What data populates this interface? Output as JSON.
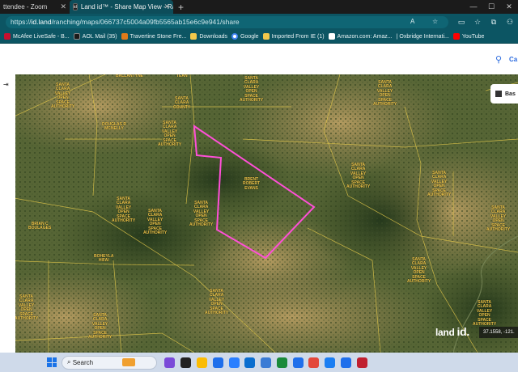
{
  "browser": {
    "tabs": [
      {
        "title": "ttendee - Zoom"
      },
      {
        "title": "Land id™ - Share Map View - Ra"
      }
    ],
    "tab_favicon_text": "id",
    "new_tab_symbol": "+",
    "url_prefix": "https://",
    "url_host": "id.land",
    "url_path": "/ranching/maps/066737c5004a09fb5565ab15e6c9e941/share",
    "bookmarks": [
      {
        "label": "McAfee LiveSafe - B...",
        "color": "#c8102e"
      },
      {
        "label": "AOL Mail (35)",
        "color": "#1a1a1a"
      },
      {
        "label": "Travertine Stone Fre...",
        "color": "#e07b1a"
      },
      {
        "label": "Downloads",
        "color": "#f2c84b"
      },
      {
        "label": "Google",
        "color": "#4285f4"
      },
      {
        "label": "Imported From IE (1)",
        "color": "#f2c84b"
      },
      {
        "label": "Amazon.com: Amaz...",
        "color": "#111111"
      },
      {
        "label": "| Oxbridge Internati...",
        "color": "#0c5563"
      },
      {
        "label": "YouTube",
        "color": "#ff0000"
      }
    ]
  },
  "site": {
    "location_label": "Ca",
    "basemap_label": "Bas",
    "logo_text": "land",
    "logo_id": "id.",
    "coordinates": "37.1558, -121."
  },
  "map_labels": [
    {
      "text": "BALLANTYNE"
    },
    {
      "text": "TEAN"
    },
    {
      "text": "SANTA\nCLARA\nVALLEY\nOPEN\nSPACE\nAUTHORITY"
    },
    {
      "text": "SANTA\nCLARA\nCOUNTY"
    },
    {
      "text": "SANTA\nCLARA\nVALLEY\nOPEN\nSPACE\nAUTHORITY"
    },
    {
      "text": "SANTA\nCLARA\nVALLEY\nOPEN\nSPACE\nAUTHORITY"
    },
    {
      "text": "DOUGLAS R\nMCNELLY"
    },
    {
      "text": "SANTA\nCLARA\nVALLEY\nOPEN\nSPACE\nAUTHORITY"
    },
    {
      "text": "BRENT\nROBERT\nEVANS"
    },
    {
      "text": "SANTA\nCLARA\nVALLEY\nOPEN\nSPACE\nAUTHORITY"
    },
    {
      "text": "SANTA\nCLARA\nVALLEY\nOPEN\nSPACE\nAUTHORITY"
    },
    {
      "text": "BRIAN C\nBOULAGES"
    },
    {
      "text": "SANTA\nCLARA\nVALLEY\nOPEN\nSPACE\nAUTHORITY"
    },
    {
      "text": "SANTA\nCLARA\nVALLEY\nOPEN\nSPACE\nAUTHORITY"
    },
    {
      "text": "SANTA\nCLARA\nVALLEY\nOPEN\nSPACE\nAUTHORITY"
    },
    {
      "text": "SANTA\nCLARA\nVALLEY\nOPEN\nSPACE\nAUTHORITY"
    },
    {
      "text": "BOHEYLA\nHIFAI"
    },
    {
      "text": "SANTA\nCLARA\nVALLEY\nOPEN\nSPACE\nAUTHORITY"
    },
    {
      "text": "SANTA\nCLARA\nVALLEY\nOPEN\nSPACE\nAUTHORITY"
    },
    {
      "text": "SANTA\nCLARA\nVALLEY\nOPEN\nSPACE\nAUTHORITY"
    },
    {
      "text": "SANTA\nCLARA\nVALLEY\nOPEN\nSPACE\nAUTHORITY"
    },
    {
      "text": "SANTA\nCLARA\nVALLEY\nOPEN\nSPACE\nAUTHORITY"
    }
  ],
  "taskbar": {
    "search_placeholder": "Search",
    "icon_colors": [
      "#7a4ad8",
      "#222222",
      "#fbbc05",
      "#1f6feb",
      "#2a7fff",
      "#0a6ecf",
      "#3a7bd5",
      "#1a8a3a",
      "#1f6feb",
      "#e3483b",
      "#1b7ef2",
      "#1f6feb",
      "#c02030"
    ]
  }
}
